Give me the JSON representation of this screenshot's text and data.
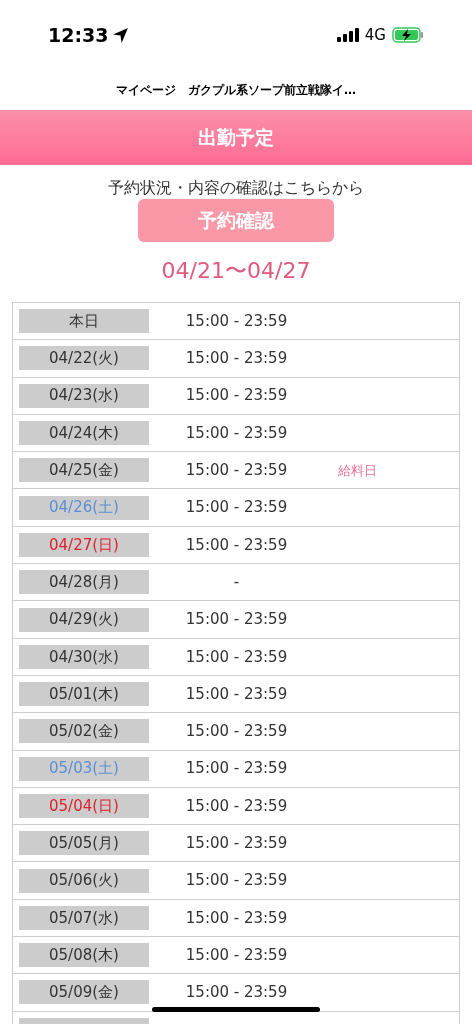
{
  "status_bar": {
    "time": "12:33",
    "network": "4G"
  },
  "nav": {
    "title": "マイページ　ガクプル系ソープ前立戦隊イ…"
  },
  "header": {
    "title": "出勤予定"
  },
  "reservation": {
    "prompt": "予約状況・内容の確認はこちらから",
    "button": "予約確認"
  },
  "week_range": "04/21〜04/27",
  "schedule": [
    {
      "date": "本日",
      "color": "#333333",
      "time": "15:00 - 23:59"
    },
    {
      "date": "04/22(火)",
      "color": "#333333",
      "time": "15:00 - 23:59"
    },
    {
      "date": "04/23(水)",
      "color": "#333333",
      "time": "15:00 - 23:59"
    },
    {
      "date": "04/24(木)",
      "color": "#333333",
      "time": "15:00 - 23:59"
    },
    {
      "date": "04/25(金)",
      "color": "#333333",
      "time": "15:00 - 23:59",
      "note": "給料日"
    },
    {
      "date": "04/26(土)",
      "color": "#5b8fd6",
      "time": "15:00 - 23:59"
    },
    {
      "date": "04/27(日)",
      "color": "#e0202a",
      "time": "15:00 - 23:59"
    },
    {
      "date": "04/28(月)",
      "color": "#333333",
      "time": "-"
    },
    {
      "date": "04/29(火)",
      "color": "#333333",
      "time": "15:00 - 23:59"
    },
    {
      "date": "04/30(水)",
      "color": "#333333",
      "time": "15:00 - 23:59"
    },
    {
      "date": "05/01(木)",
      "color": "#333333",
      "time": "15:00 - 23:59"
    },
    {
      "date": "05/02(金)",
      "color": "#333333",
      "time": "15:00 - 23:59"
    },
    {
      "date": "05/03(土)",
      "color": "#5b8fd6",
      "time": "15:00 - 23:59"
    },
    {
      "date": "05/04(日)",
      "color": "#e0202a",
      "time": "15:00 - 23:59"
    },
    {
      "date": "05/05(月)",
      "color": "#333333",
      "time": "15:00 - 23:59"
    },
    {
      "date": "05/06(火)",
      "color": "#333333",
      "time": "15:00 - 23:59"
    },
    {
      "date": "05/07(水)",
      "color": "#333333",
      "time": "15:00 - 23:59"
    },
    {
      "date": "05/08(木)",
      "color": "#333333",
      "time": "15:00 - 23:59"
    },
    {
      "date": "05/09(金)",
      "color": "#333333",
      "time": "15:00 - 23:59"
    }
  ],
  "more_rows_below": true
}
